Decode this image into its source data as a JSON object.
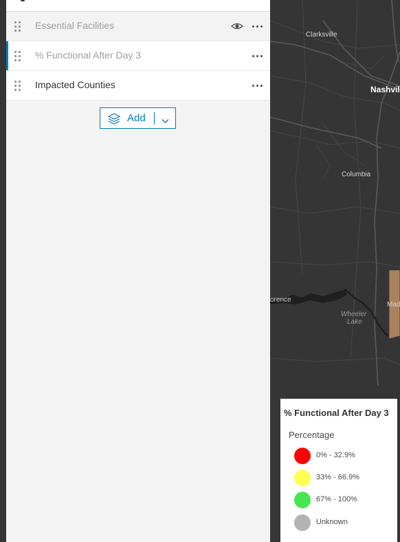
{
  "panel": {
    "layers": [
      {
        "label": "Essential Facilities"
      },
      {
        "label": "% Functional After Day 3"
      },
      {
        "label": "Impacted Counties"
      }
    ],
    "add_label": "Add"
  },
  "map": {
    "labels": {
      "clarksville": "Clarksville",
      "nashville": "Nashvill",
      "columbia": "Columbia",
      "florence": "orence",
      "wheeler": "Wheeler",
      "lake": "Lake",
      "madison": "Mad"
    },
    "county_color": "#a9835f"
  },
  "legend": {
    "title": "% Functional After Day 3",
    "field": "Percentage",
    "items": [
      {
        "label": "0% - 32.9%",
        "color": "#ff0000"
      },
      {
        "label": "33% - 66.9%",
        "color": "#ffff4d"
      },
      {
        "label": "67% - 100%",
        "color": "#45e64f"
      },
      {
        "label": "Unknown",
        "color": "#b3b3b3"
      }
    ]
  },
  "colors": {
    "accent": "#0079c1",
    "map_background": "#353535"
  }
}
